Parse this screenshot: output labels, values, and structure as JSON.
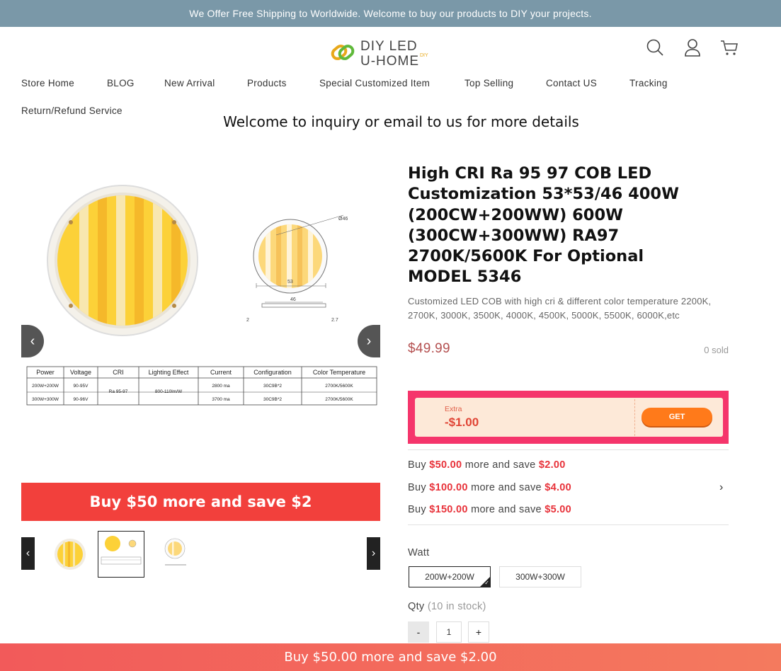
{
  "announcement": "We Offer Free Shipping to Worldwide. Welcome to buy our products to DIY your projects.",
  "logo": {
    "line1": "DIY LED",
    "line2": "U-HOME",
    "tag": "DIY"
  },
  "header_icons": [
    "search-icon",
    "account-icon",
    "cart-icon"
  ],
  "nav": {
    "items": [
      "Store Home",
      "BLOG",
      "New Arrival",
      "Products",
      "Special Customized Item",
      "Top Selling",
      "Contact US",
      "Tracking",
      "Return/Refund Service"
    ]
  },
  "welcome_text": "Welcome to inquiry or email to us for more details",
  "gallery": {
    "promo_banner": "Buy $50 more and save $2",
    "spec_table": {
      "headers": [
        "Power",
        "Voltage",
        "CRI",
        "Lighting Effect",
        "Current",
        "Configuration",
        "Color Temperature"
      ],
      "rows": [
        [
          "200W+200W",
          "90-95V",
          "Ra 95-97",
          "800-110lm/W",
          "2800 ma",
          "30C9B*2",
          "2700K/5600K"
        ],
        [
          "300W+300W",
          "90-96V",
          "",
          "",
          "3700 ma",
          "30C9B*2",
          "2700K/5600K"
        ]
      ]
    },
    "drawing_labels": {
      "diameter": "Ø46",
      "width": "53",
      "inner": "46",
      "thick": "2.7",
      "side": "2"
    }
  },
  "product": {
    "title": "High CRI Ra 95 97 COB LED Customization 53*53/46 400W (200CW+200WW) 600W (300CW+300WW) RA97 2700K/5600K For Optional MODEL 5346",
    "description": "Customized LED COB with high cri & different color temperature 2200K, 2700K, 3000K, 3500K, 4000K, 4500K, 5000K, 5500K, 6000K,etc",
    "price": "$49.99",
    "sold": "0 sold"
  },
  "coupon": {
    "label": "Extra",
    "amount": "-$1.00",
    "button": "GET"
  },
  "tiers": [
    {
      "pre": "Buy ",
      "amount": "$50.00",
      "mid": " more and save ",
      "save": "$2.00"
    },
    {
      "pre": "Buy ",
      "amount": "$100.00",
      "mid": " more and save ",
      "save": "$4.00"
    },
    {
      "pre": "Buy ",
      "amount": "$150.00",
      "mid": " more and save ",
      "save": "$5.00"
    }
  ],
  "watt": {
    "label": "Watt",
    "options": [
      "200W+200W",
      "300W+300W"
    ],
    "selected": "200W+200W"
  },
  "qty": {
    "label": "Qty",
    "stock": "(10 in stock)",
    "value": "1",
    "minus": "-",
    "plus": "+"
  },
  "bottom_bar": "Buy $50.00 more and save $2.00",
  "colors": {
    "accent_red": "#f2403c",
    "topbar": "#7a98a8",
    "coupon_pink": "#f5356b",
    "get_orange": "#ff7a1a"
  }
}
